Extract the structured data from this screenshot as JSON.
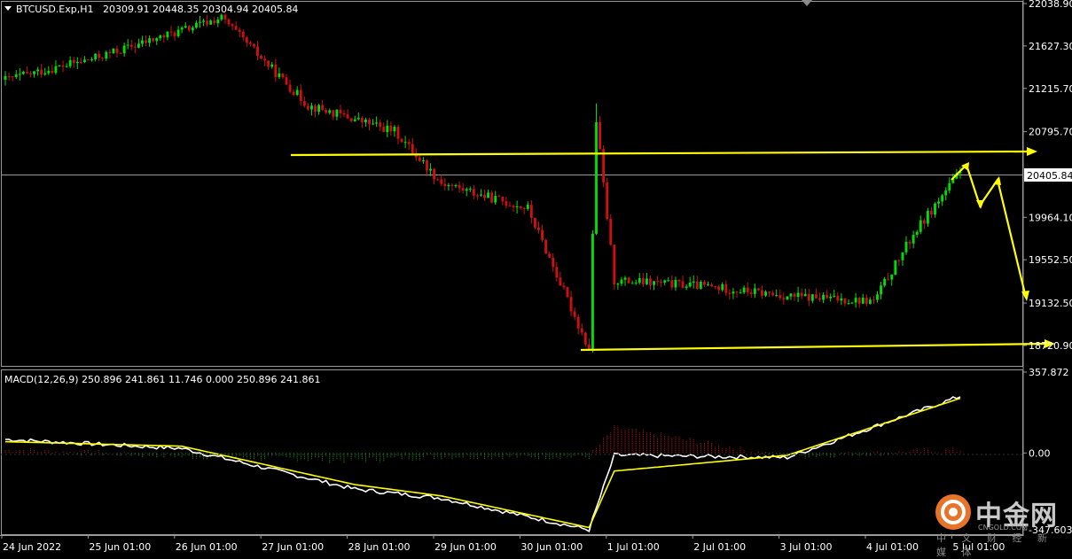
{
  "header": {
    "symbol": "BTCUSD.Exp,H1",
    "ohlc": "20309.91 20448.35 20304.94 20405.84"
  },
  "macd_header": "MACD(12,26,9) 250.896 241.861 11.746 0.000 250.896 241.861",
  "watermark": {
    "title": "中金网",
    "url": "CNGOLD.COM",
    "subtitle": "中 文 财 经 新 媒 体"
  },
  "colors": {
    "background": "#000000",
    "bull": "#00e000",
    "bear": "#d01010",
    "signal": "#ffff00",
    "macd_line": "#ffffff",
    "hist_pos": "#d01818",
    "hist_neg": "#1e9a1e",
    "annotation": "#ffff00"
  },
  "chart_data": [
    {
      "type": "candlestick",
      "title": "BTCUSD.Exp,H1",
      "ylim": [
        18600,
        22038.9
      ],
      "y_ticks": [
        "22038.90",
        "21627.30",
        "21215.70",
        "20795.70",
        "20405.84",
        "19964.10",
        "19552.50",
        "19132.50",
        "18720.90"
      ],
      "current_price": 20405.84,
      "x_ticks": [
        "24 Jun 2022",
        "25 Jun 01:00",
        "26 Jun 01:00",
        "27 Jun 01:00",
        "28 Jun 01:00",
        "29 Jun 01:00",
        "30 Jun 01:00",
        "1 Jul 01:00",
        "2 Jul 01:00",
        "3 Jul 01:00",
        "4 Jul 01:00",
        "5 Jul 01:00"
      ],
      "key_points": [
        {
          "x": "24 Jun 2022",
          "y": 21300
        },
        {
          "x": "25 Jun",
          "y": 21500
        },
        {
          "x": "26 Jun 12:00",
          "y": 21900
        },
        {
          "x": "27 Jun 12:00",
          "y": 21050
        },
        {
          "x": "28 Jun 12:00",
          "y": 20800
        },
        {
          "x": "29 Jun 01:00",
          "y": 20300
        },
        {
          "x": "29 Jun 12:00",
          "y": 20180
        },
        {
          "x": "30 Jun 01:00",
          "y": 20050
        },
        {
          "x": "30 Jun 18:00",
          "y": 18680
        },
        {
          "x": "30 Jun 20:00",
          "y": 20900
        },
        {
          "x": "1 Jul 01:00",
          "y": 19350
        },
        {
          "x": "2 Jul 01:00",
          "y": 19300
        },
        {
          "x": "3 Jul 01:00",
          "y": 19200
        },
        {
          "x": "4 Jul 01:00",
          "y": 19150
        },
        {
          "x": "4 Jul 12:00",
          "y": 19800
        },
        {
          "x": "5 Jul 01:00",
          "y": 20405.84
        }
      ],
      "annotations": [
        {
          "type": "horizontal-line",
          "label": "resistance",
          "y_start": 20580,
          "y_end": 20600
        },
        {
          "type": "horizontal-line",
          "label": "support",
          "y_start": 18690,
          "y_end": 18740
        },
        {
          "type": "projection-arrows",
          "path": [
            20405,
            20550,
            20000,
            20480,
            19230
          ]
        }
      ]
    },
    {
      "type": "macd",
      "title": "MACD(12,26,9) 250.896 241.861 11.746 0.000 250.896 241.861",
      "params": [
        12,
        26,
        9
      ],
      "values": {
        "macd": 250.896,
        "signal": 241.861,
        "histogram": 11.746
      },
      "ylim": [
        -347.603,
        357.872
      ],
      "y_ticks": [
        "357.872",
        "0.00",
        "-347.603"
      ],
      "key_points": [
        {
          "x": "24 Jun 2022",
          "macd": 60,
          "signal": 50
        },
        {
          "x": "26 Jun 01:00",
          "macd": 20,
          "signal": 30
        },
        {
          "x": "28 Jun 01:00",
          "macd": -160,
          "signal": -140
        },
        {
          "x": "29 Jun 01:00",
          "macd": -200,
          "signal": -190
        },
        {
          "x": "30 Jun 18:00",
          "macd": -340,
          "signal": -330
        },
        {
          "x": "1 Jul 01:00",
          "macd": -10,
          "signal": -80
        },
        {
          "x": "3 Jul 01:00",
          "macd": -20,
          "signal": -10
        },
        {
          "x": "5 Jul 01:00",
          "macd": 250.896,
          "signal": 241.861
        }
      ]
    }
  ]
}
